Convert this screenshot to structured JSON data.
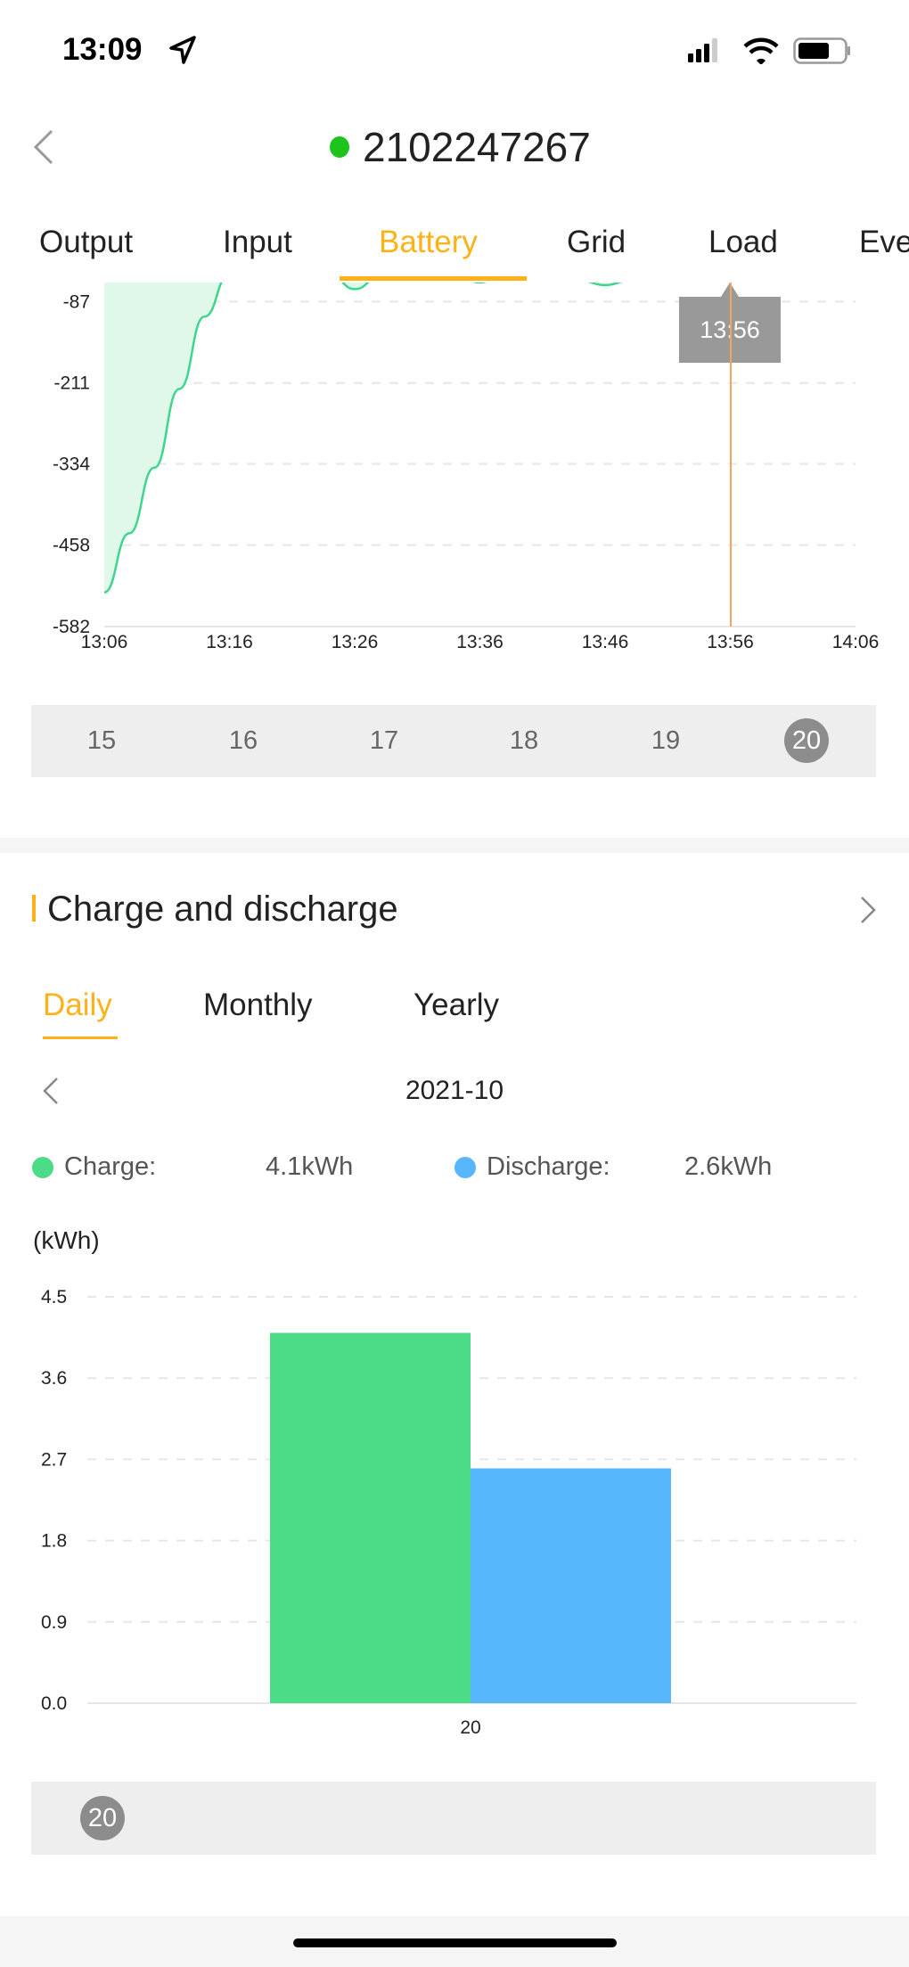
{
  "status_bar": {
    "time": "13:09",
    "icons": [
      "location-arrow-icon",
      "signal-icon",
      "wifi-icon",
      "battery-icon"
    ]
  },
  "header": {
    "title": "2102247267",
    "status_color": "#1CC41C",
    "back_icon": "chevron-left-icon"
  },
  "tabs": [
    {
      "label": "Output"
    },
    {
      "label": "Input"
    },
    {
      "label": "Battery",
      "active": true
    },
    {
      "label": "Grid"
    },
    {
      "label": "Load"
    },
    {
      "label": "Eve"
    }
  ],
  "accent": "#FFB117",
  "tooltip": {
    "label": "13:56"
  },
  "day_selector": {
    "days": [
      "15",
      "16",
      "17",
      "18",
      "19",
      "20"
    ],
    "selected": "20"
  },
  "section": {
    "title": "Charge and discharge",
    "chevron_icon": "chevron-right-icon",
    "tabs": [
      {
        "label": "Daily",
        "active": true
      },
      {
        "label": "Monthly"
      },
      {
        "label": "Yearly"
      }
    ],
    "period": "2021-10",
    "legend": [
      {
        "label": "Charge:",
        "value": "4.1kWh",
        "color": "#4CDB87"
      },
      {
        "label": "Discharge:",
        "value": "2.6kWh",
        "color": "#58B6FD"
      }
    ],
    "unit": "(kWh)"
  },
  "bottom_selector": {
    "days": [
      "20"
    ],
    "selected": "20"
  },
  "chart_data": [
    {
      "type": "area",
      "xlabel": "",
      "ylabel": "",
      "x_ticks": [
        "13:06",
        "13:16",
        "13:26",
        "13:36",
        "13:46",
        "13:56",
        "14:06"
      ],
      "y_ticks": [
        "-87",
        "-211",
        "-334",
        "-458",
        "-582"
      ],
      "ylim": [
        -582,
        -58
      ],
      "grid": true,
      "color": "#3DD68C",
      "fill": "#DFF8EA",
      "x": [
        "13:06",
        "13:08",
        "13:10",
        "13:12",
        "13:14",
        "13:16",
        "13:20",
        "13:24",
        "13:26",
        "13:28",
        "13:32",
        "13:36",
        "13:40",
        "13:44",
        "13:46",
        "13:48",
        "13:52",
        "13:56"
      ],
      "y": [
        -530,
        -440,
        -340,
        -220,
        -110,
        -45,
        0,
        -45,
        -68,
        -50,
        0,
        -58,
        0,
        -55,
        -62,
        -55,
        0,
        0
      ],
      "cursor": "13:56"
    },
    {
      "type": "bar",
      "categories": [
        "20"
      ],
      "ylabel": "(kWh)",
      "ylim": [
        0,
        4.5
      ],
      "y_ticks": [
        "4.5",
        "3.6",
        "2.7",
        "1.8",
        "0.9",
        "0.0"
      ],
      "grid": true,
      "series": [
        {
          "name": "Charge",
          "values": [
            4.1
          ],
          "color": "#4CDB87"
        },
        {
          "name": "Discharge",
          "values": [
            2.6
          ],
          "color": "#58B6FD"
        }
      ]
    }
  ]
}
